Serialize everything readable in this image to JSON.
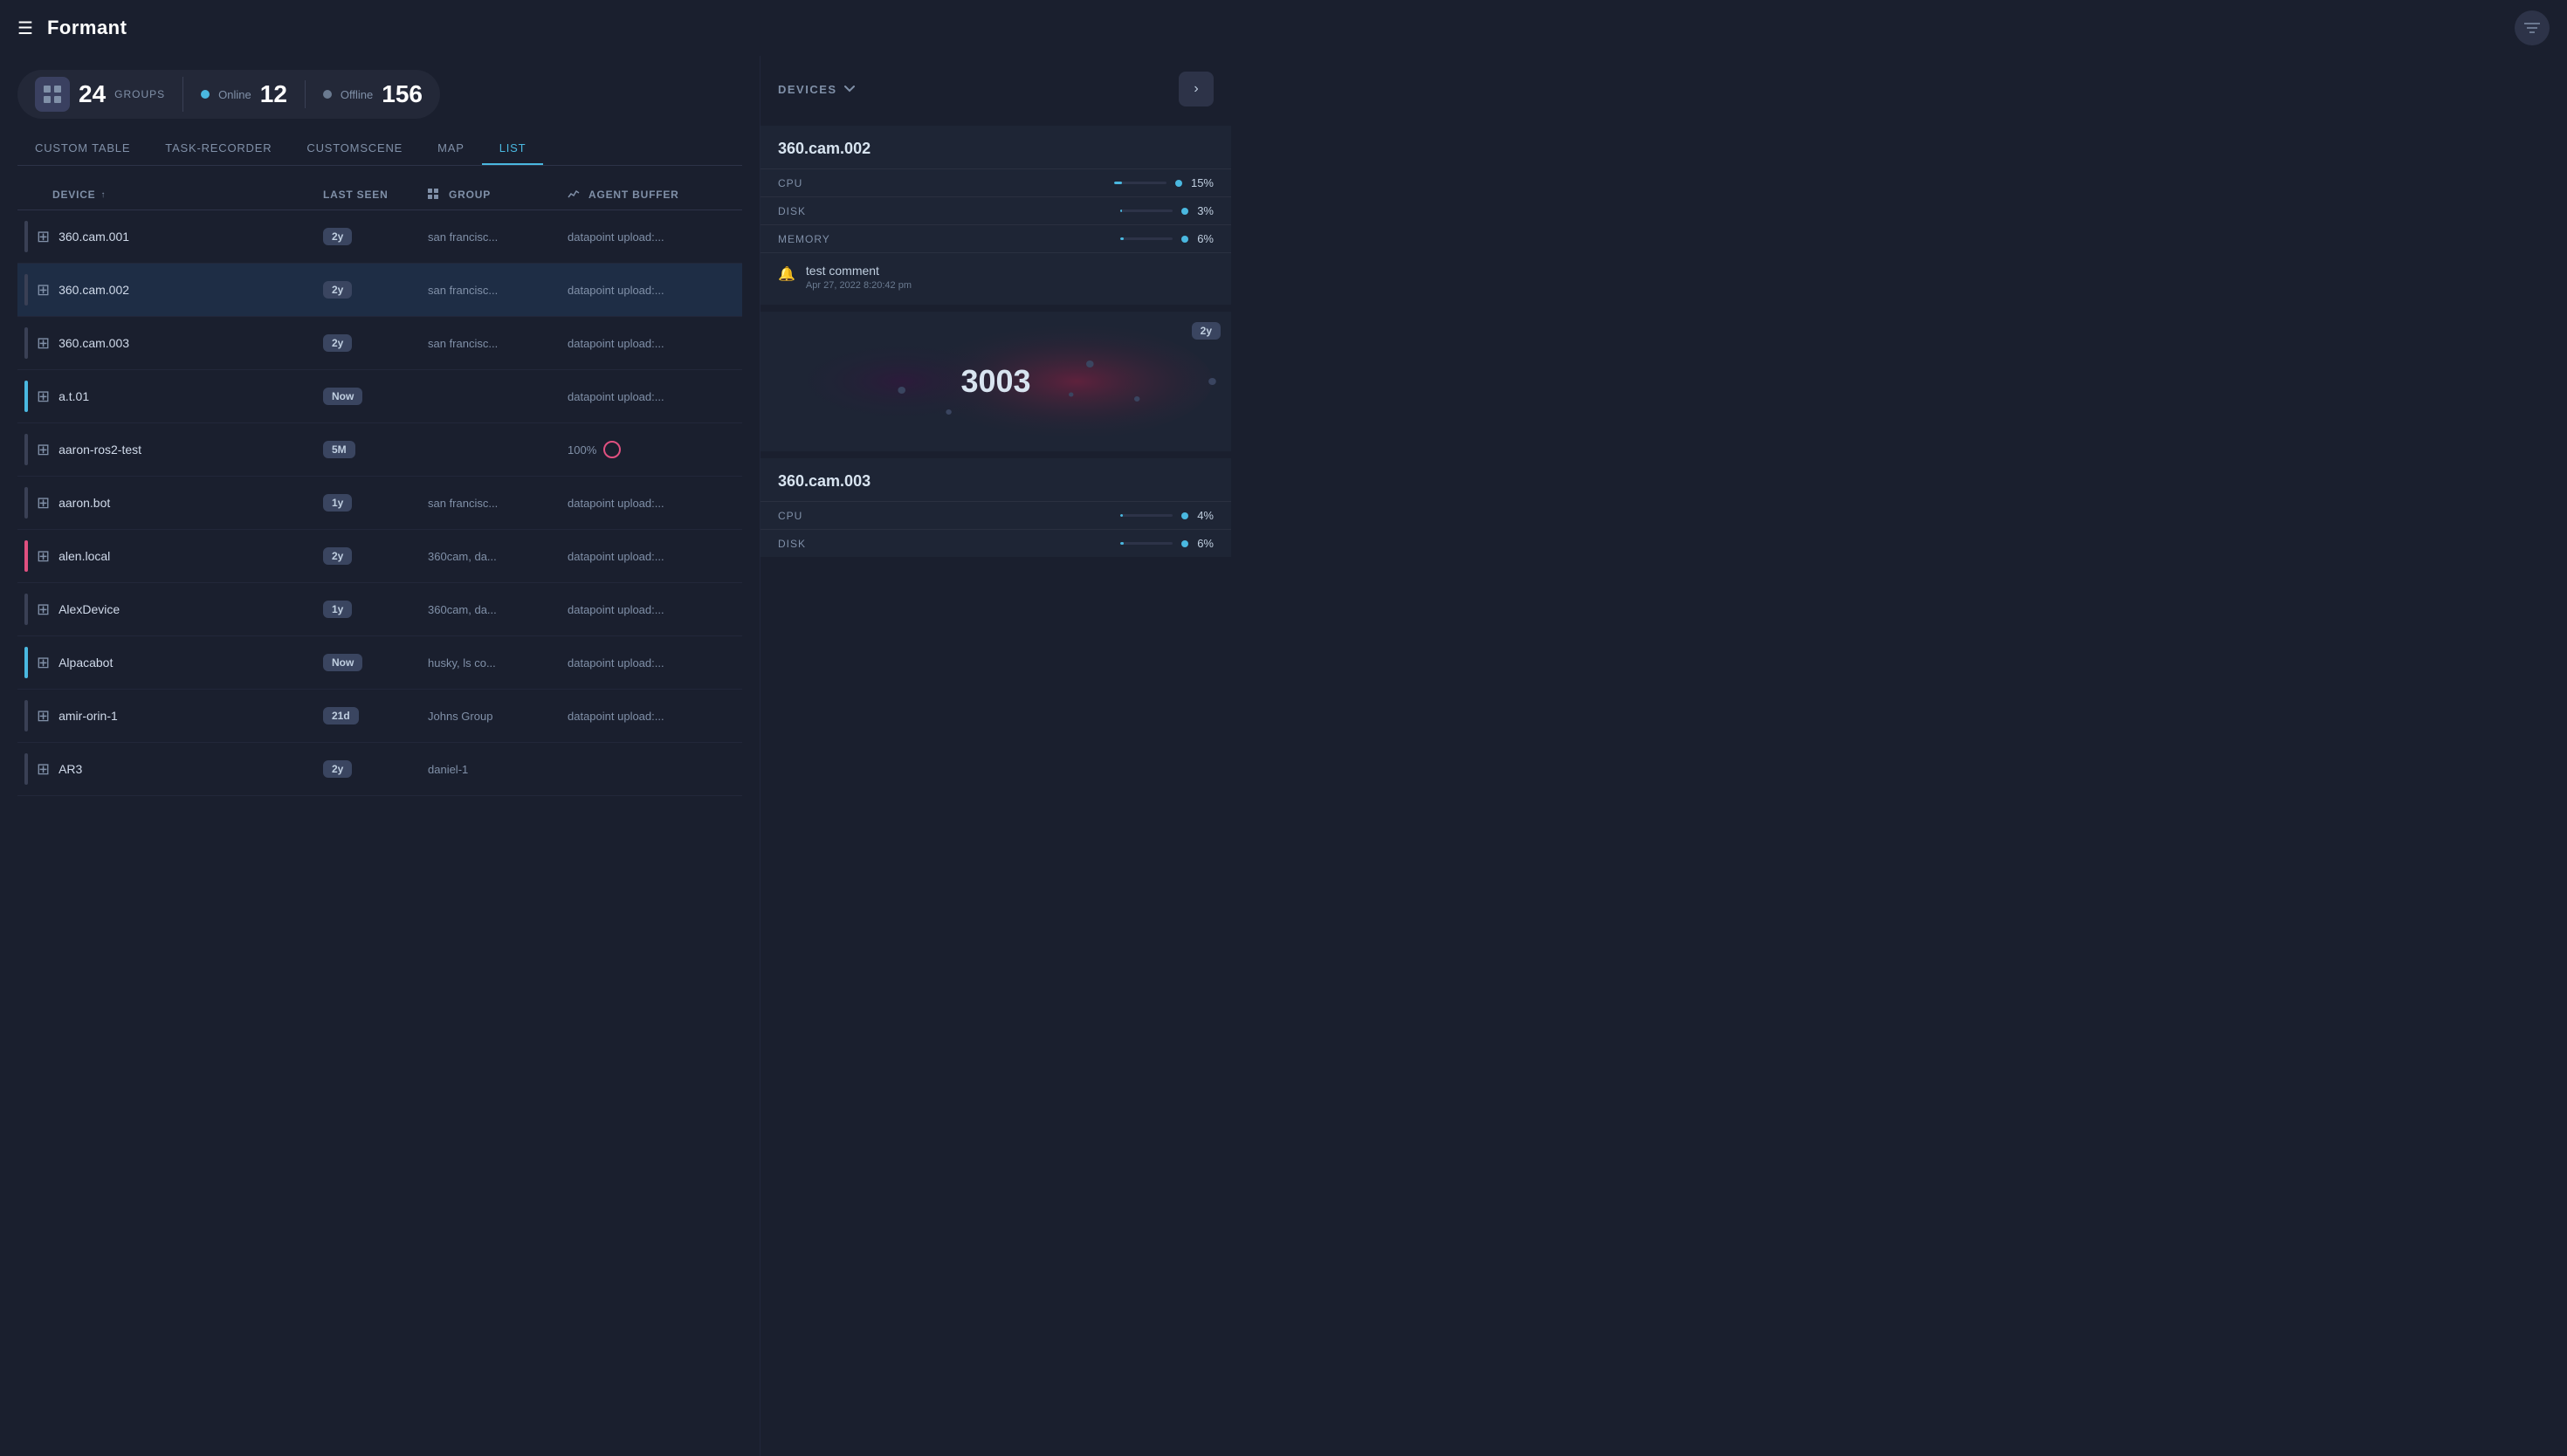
{
  "app": {
    "name": "Formant"
  },
  "header": {
    "filter_label": "filter"
  },
  "stats": {
    "groups_count": "24",
    "groups_label": "GROUPS",
    "online_label": "Online",
    "online_count": "12",
    "offline_label": "Offline",
    "offline_count": "156"
  },
  "tabs": [
    {
      "id": "custom-table",
      "label": "CUSTOM TABLE",
      "active": false
    },
    {
      "id": "task-recorder",
      "label": "TASK-RECORDER",
      "active": false
    },
    {
      "id": "customscene",
      "label": "CUSTOMSCENE",
      "active": false
    },
    {
      "id": "map",
      "label": "MAP",
      "active": false
    },
    {
      "id": "list",
      "label": "LIST",
      "active": true
    }
  ],
  "table": {
    "columns": [
      {
        "id": "device",
        "label": "DEVICE",
        "sortable": true,
        "sorted": true,
        "sort_dir": "asc"
      },
      {
        "id": "last-seen",
        "label": "LAST SEEN",
        "sortable": false
      },
      {
        "id": "group",
        "label": "GROUP",
        "sortable": false
      },
      {
        "id": "agent-buffer",
        "label": "AGENT BUFFER",
        "sortable": false
      }
    ],
    "rows": [
      {
        "id": "360cam001",
        "name": "360.cam.001",
        "indicator": "normal",
        "last_seen": "2y",
        "group": "san francisc...",
        "agent": "datapoint upload:...",
        "extra": ""
      },
      {
        "id": "360cam002",
        "name": "360.cam.002",
        "indicator": "normal",
        "last_seen": "2y",
        "group": "san francisc...",
        "agent": "datapoint upload:...",
        "extra": "",
        "selected": true
      },
      {
        "id": "360cam003",
        "name": "360.cam.003",
        "indicator": "normal",
        "last_seen": "2y",
        "group": "san francisc...",
        "agent": "datapoint upload:...",
        "extra": ""
      },
      {
        "id": "at01",
        "name": "a.t.01",
        "indicator": "online",
        "last_seen": "Now",
        "group": "",
        "agent": "datapoint upload:...",
        "extra": ""
      },
      {
        "id": "aaron-ros2-test",
        "name": "aaron-ros2-test",
        "indicator": "normal",
        "last_seen": "5M",
        "group": "",
        "agent": "100%",
        "extra": "circle"
      },
      {
        "id": "aaron-bot",
        "name": "aaron.bot",
        "indicator": "normal",
        "last_seen": "1y",
        "group": "san francisc...",
        "agent": "datapoint upload:...",
        "extra": ""
      },
      {
        "id": "alen-local",
        "name": "alen.local",
        "indicator": "pink",
        "last_seen": "2y",
        "group": "360cam, da...",
        "agent": "datapoint upload:...",
        "extra": ""
      },
      {
        "id": "alex-device",
        "name": "AlexDevice",
        "indicator": "normal",
        "last_seen": "1y",
        "group": "360cam, da...",
        "agent": "datapoint upload:...",
        "extra": ""
      },
      {
        "id": "alpacabot",
        "name": "Alpacabot",
        "indicator": "online",
        "last_seen": "Now",
        "group": "husky, ls co...",
        "agent": "datapoint upload:...",
        "extra": ""
      },
      {
        "id": "amir-orin-1",
        "name": "amir-orin-1",
        "indicator": "normal",
        "last_seen": "21d",
        "group": "Johns Group",
        "agent": "datapoint upload:...",
        "extra": ""
      },
      {
        "id": "ar3",
        "name": "AR3",
        "indicator": "normal",
        "last_seen": "2y",
        "group": "daniel-1",
        "agent": "",
        "extra": ""
      }
    ]
  },
  "right_panel": {
    "devices_label": "DEVICES",
    "expand_arrow": "›",
    "cards": [
      {
        "id": "card-360cam002",
        "title": "360.cam.002",
        "stats": [
          {
            "name": "CPU",
            "value": "15%",
            "bar_pct": 15
          },
          {
            "name": "DISK",
            "value": "3%",
            "bar_pct": 3
          },
          {
            "name": "MEMORY",
            "value": "6%",
            "bar_pct": 6
          }
        ],
        "comment": {
          "text": "test comment",
          "date": "Apr 27, 2022 8:20:42 pm"
        }
      },
      {
        "id": "card-viz",
        "type": "visualization",
        "badge": "2y",
        "value": "3003"
      },
      {
        "id": "card-360cam003",
        "title": "360.cam.003",
        "stats": [
          {
            "name": "CPU",
            "value": "4%",
            "bar_pct": 4
          },
          {
            "name": "DISK",
            "value": "6%",
            "bar_pct": 6
          }
        ]
      }
    ]
  }
}
